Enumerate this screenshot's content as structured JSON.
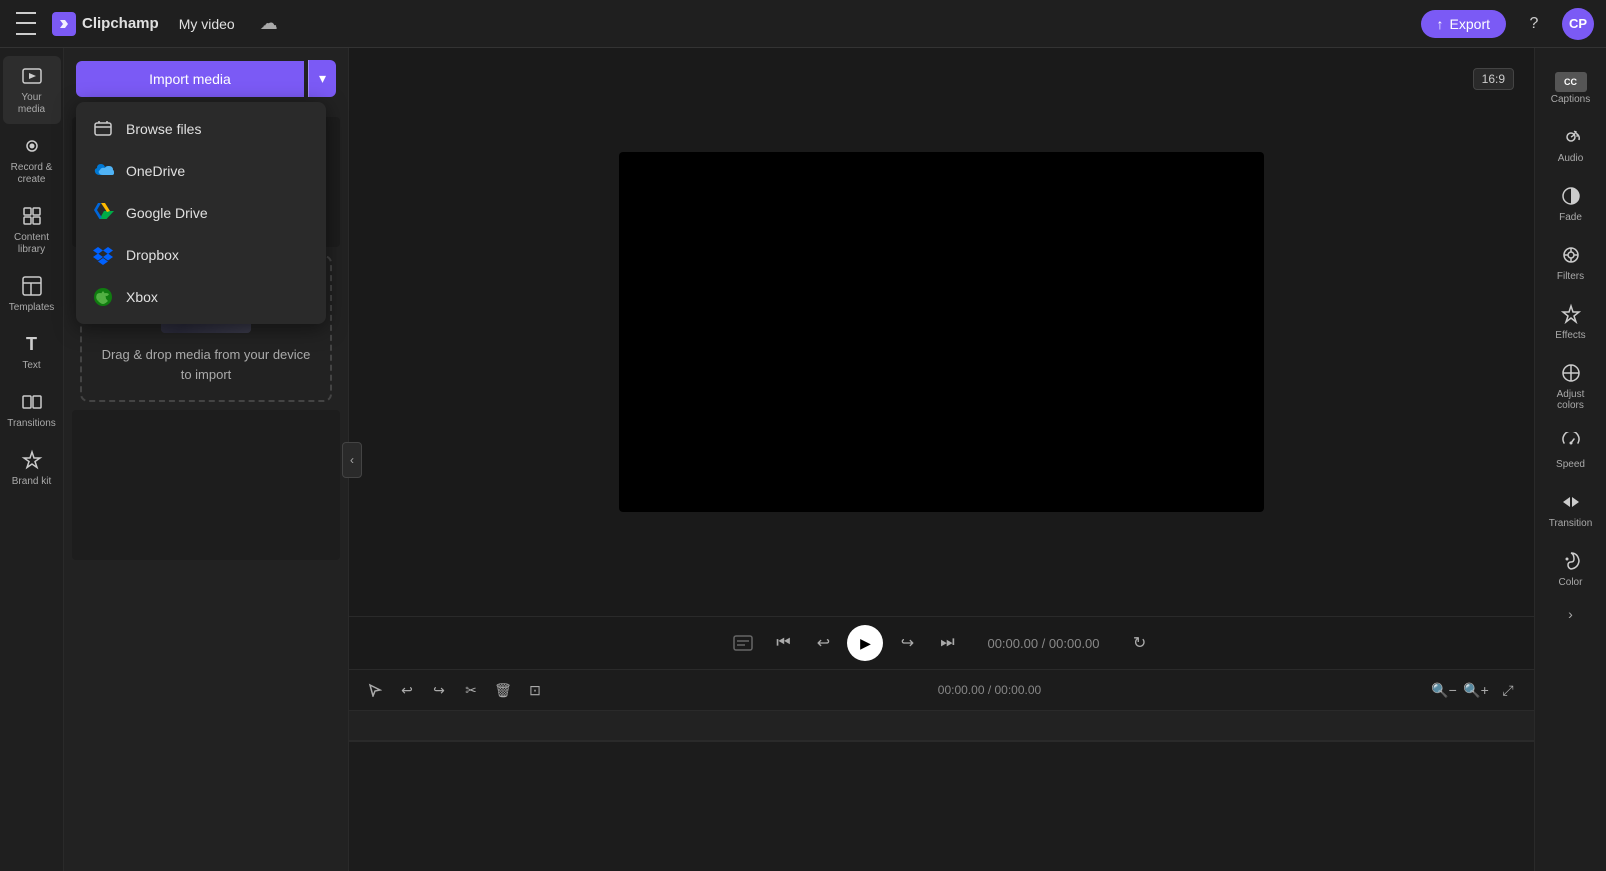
{
  "app": {
    "name": "Clipchamp",
    "logo_letter": "C"
  },
  "topbar": {
    "hamburger_label": "Menu",
    "logo_text": "Clipchamp",
    "video_title": "My video",
    "export_label": "Export",
    "help_icon": "?",
    "avatar_initials": "CP"
  },
  "left_sidebar": {
    "items": [
      {
        "id": "your-media",
        "label": "Your media",
        "icon": "🎬"
      },
      {
        "id": "record-create",
        "label": "Record & create",
        "icon": "📹"
      },
      {
        "id": "content-library",
        "label": "Content library",
        "icon": "🗂️"
      },
      {
        "id": "templates",
        "label": "Templates",
        "icon": "⊞"
      },
      {
        "id": "text",
        "label": "Text",
        "icon": "T"
      },
      {
        "id": "transitions",
        "label": "Transitions",
        "icon": "⧉"
      },
      {
        "id": "brand-kit",
        "label": "Brand kit",
        "icon": "🏷️"
      }
    ]
  },
  "media_panel": {
    "import_button_label": "Import media",
    "dropdown_arrow": "▾",
    "dropdown_items": [
      {
        "id": "browse-files",
        "label": "Browse files"
      },
      {
        "id": "onedrive",
        "label": "OneDrive"
      },
      {
        "id": "google-drive",
        "label": "Google Drive"
      },
      {
        "id": "dropbox",
        "label": "Dropbox"
      },
      {
        "id": "xbox",
        "label": "Xbox"
      }
    ],
    "drag_drop_text": "Drag & drop media from your device to import"
  },
  "video_preview": {
    "aspect_ratio": "16:9"
  },
  "playback": {
    "timestamp": "00:00.00 / 00:00.00"
  },
  "right_sidebar": {
    "captions_label": "Captions",
    "captions_icon_text": "CC",
    "items": [
      {
        "id": "audio",
        "label": "Audio",
        "icon": "🔊"
      },
      {
        "id": "fade",
        "label": "Fade",
        "icon": "◑"
      },
      {
        "id": "filters",
        "label": "Filters",
        "icon": "⊜"
      },
      {
        "id": "effects",
        "label": "Effects",
        "icon": "✦"
      },
      {
        "id": "adjust-colors",
        "label": "Adjust colors",
        "icon": "⊕"
      },
      {
        "id": "speed",
        "label": "Speed",
        "icon": "⟳"
      },
      {
        "id": "transition",
        "label": "Transition",
        "icon": "⇄"
      },
      {
        "id": "color",
        "label": "Color",
        "icon": "🎨"
      }
    ]
  }
}
